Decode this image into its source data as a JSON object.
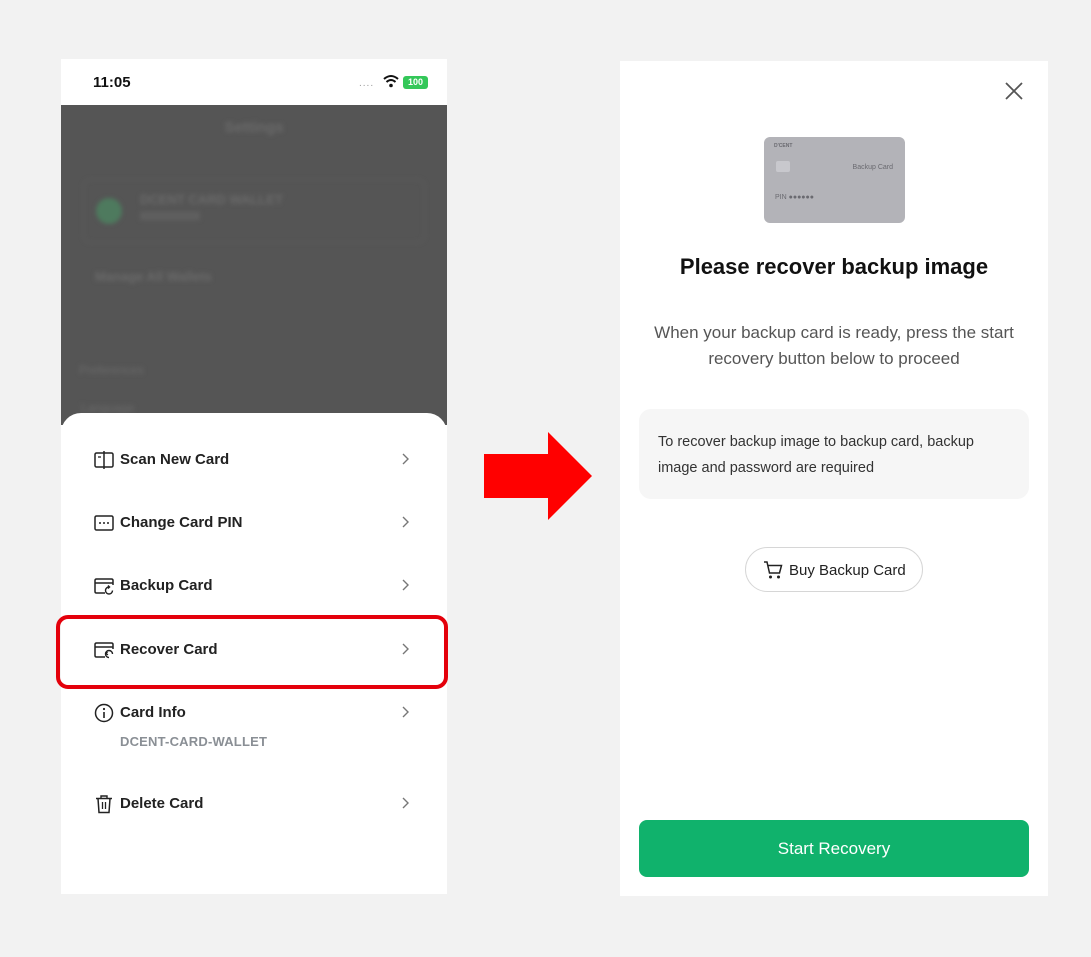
{
  "left_screen": {
    "status_bar": {
      "time": "11:05",
      "signal": "....",
      "battery": "100"
    },
    "background": {
      "title": "Settings",
      "card_wallet": "DCENT CARD WALLET",
      "manage_wallets": "Manage All Wallets",
      "section": "Preferences",
      "language": "Language"
    },
    "menu": [
      {
        "label": "Scan New Card",
        "icon": "scan-card-icon"
      },
      {
        "label": "Change Card PIN",
        "icon": "pin-card-icon"
      },
      {
        "label": "Backup Card",
        "icon": "backup-card-icon"
      },
      {
        "label": "Recover Card",
        "icon": "recover-card-icon",
        "highlighted": true
      },
      {
        "label": "Card Info",
        "icon": "info-icon",
        "sub": "DCENT-CARD-WALLET"
      },
      {
        "label": "Delete Card",
        "icon": "trash-icon"
      }
    ],
    "highlight_color": "#e4000b"
  },
  "arrow": {
    "color": "#ff0000"
  },
  "right_screen": {
    "card": {
      "brand": "D'CENT",
      "name": "Backup Card",
      "pin": "PIN ●●●●●●"
    },
    "title": "Please recover backup image",
    "description": "When your backup card is ready, press the start recovery button below to proceed",
    "info": "To recover backup image to backup card, backup image and password are required",
    "buy_button": "Buy Backup Card",
    "start_button": "Start Recovery",
    "accent_color": "#10b26c"
  }
}
